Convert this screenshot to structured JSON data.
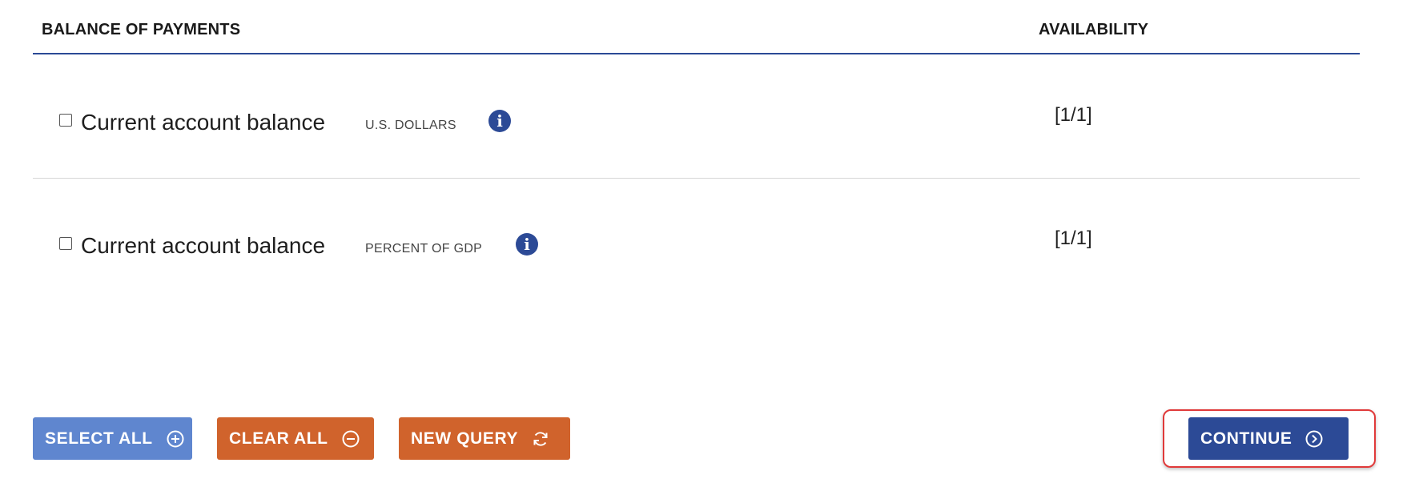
{
  "header": {
    "title": "BALANCE OF PAYMENTS",
    "availability": "AVAILABILITY"
  },
  "rows": [
    {
      "name": "Current account balance",
      "unit": "U.S. DOLLARS",
      "info_icon": "info-icon",
      "availability": "[1/1]",
      "checked": false
    },
    {
      "name": "Current account balance",
      "unit": "PERCENT OF GDP",
      "info_icon": "info-icon",
      "availability": "[1/1]",
      "checked": false
    }
  ],
  "buttons": {
    "select_all": "SELECT ALL",
    "clear_all": "CLEAR ALL",
    "new_query": "NEW QUERY",
    "continue": "CONTINUE"
  },
  "colors": {
    "primary": "#2c4a96",
    "select_all": "#5f86cf",
    "action_orange": "#d0632c",
    "highlight": "#e03a3a"
  }
}
